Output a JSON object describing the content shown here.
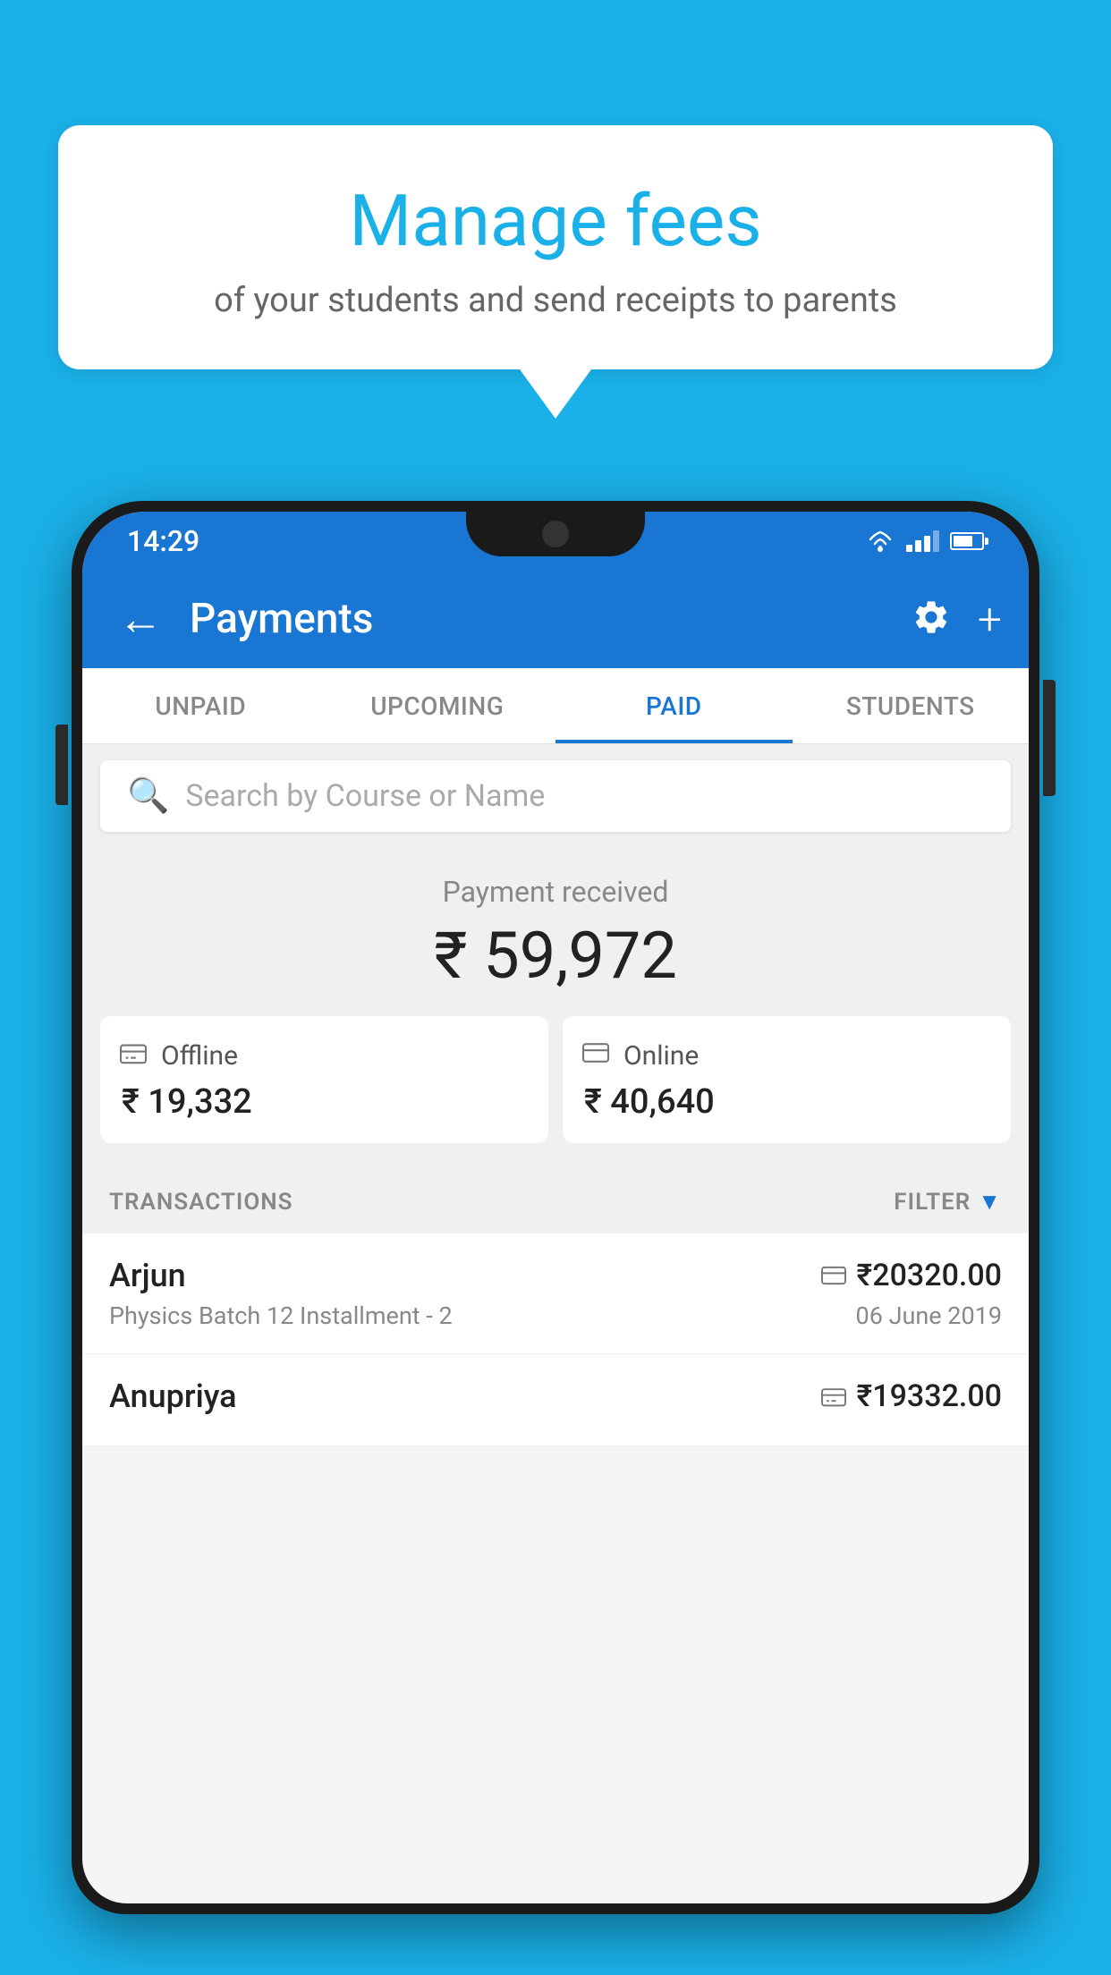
{
  "background_color": "#1ab0e8",
  "speech_bubble": {
    "title": "Manage fees",
    "subtitle": "of your students and send receipts to parents"
  },
  "status_bar": {
    "time": "14:29",
    "icons": [
      "wifi",
      "signal",
      "battery"
    ]
  },
  "app_bar": {
    "title": "Payments",
    "back_label": "←",
    "settings_label": "⚙",
    "add_label": "+"
  },
  "tabs": [
    {
      "label": "UNPAID",
      "active": false
    },
    {
      "label": "UPCOMING",
      "active": false
    },
    {
      "label": "PAID",
      "active": true
    },
    {
      "label": "STUDENTS",
      "active": false
    }
  ],
  "search": {
    "placeholder": "Search by Course or Name"
  },
  "payment_summary": {
    "label": "Payment received",
    "amount": "₹ 59,972",
    "offline": {
      "label": "Offline",
      "amount": "₹ 19,332"
    },
    "online": {
      "label": "Online",
      "amount": "₹ 40,640"
    }
  },
  "transactions": {
    "header_label": "TRANSACTIONS",
    "filter_label": "FILTER",
    "items": [
      {
        "name": "Arjun",
        "amount": "₹20320.00",
        "detail": "Physics Batch 12 Installment - 2",
        "date": "06 June 2019",
        "payment_type": "online"
      },
      {
        "name": "Anupriya",
        "amount": "₹19332.00",
        "detail": "",
        "date": "",
        "payment_type": "offline"
      }
    ]
  }
}
